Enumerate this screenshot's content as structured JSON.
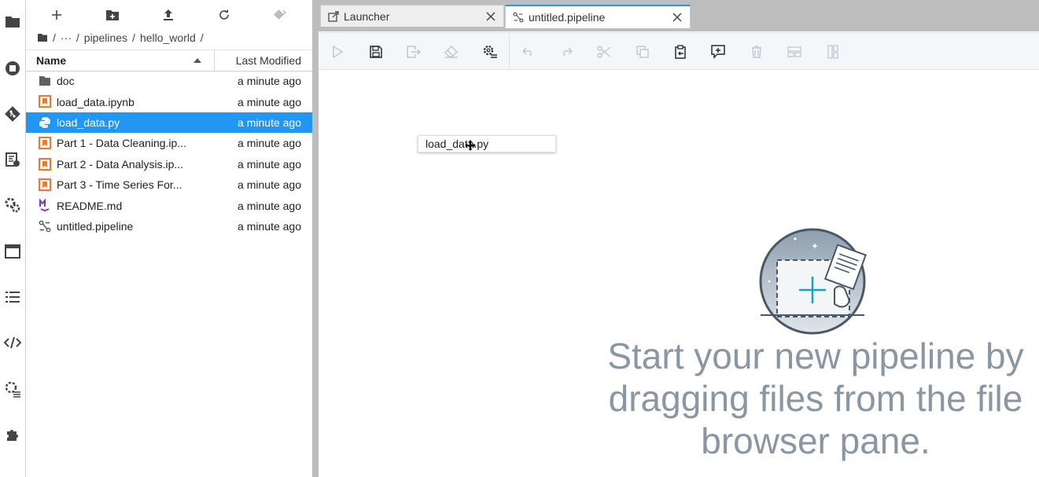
{
  "activity_bar": {
    "items": [
      {
        "name": "folder-icon"
      },
      {
        "name": "running-icon"
      },
      {
        "name": "git-icon"
      },
      {
        "name": "code-snippets-icon"
      },
      {
        "name": "runtimes-icon"
      },
      {
        "name": "tabs-icon"
      },
      {
        "name": "toc-icon"
      },
      {
        "name": "code-icon"
      },
      {
        "name": "property-inspector-icon"
      },
      {
        "name": "extension-icon"
      }
    ]
  },
  "file_browser": {
    "toolbar": [
      "new-launcher-icon",
      "new-folder-icon",
      "upload-icon",
      "refresh-icon",
      "git-clone-icon"
    ],
    "breadcrumb": {
      "root_sep": "/",
      "ellipsis": "···",
      "sep1": "/",
      "part1": "pipelines",
      "sep2": "/",
      "part2": "hello_world",
      "sep3": "/"
    },
    "columns": {
      "name": "Name",
      "modified": "Last Modified"
    },
    "sort": {
      "column": "Name",
      "direction": "ascending"
    },
    "files": [
      {
        "name": "doc",
        "modified": "a minute ago",
        "icon": "folder-icon",
        "selected": false
      },
      {
        "name": "load_data.ipynb",
        "modified": "a minute ago",
        "icon": "notebook-icon",
        "selected": false
      },
      {
        "name": "load_data.py",
        "modified": "a minute ago",
        "icon": "python-icon",
        "selected": true
      },
      {
        "name": "Part 1 - Data Cleaning.ip...",
        "modified": "a minute ago",
        "icon": "notebook-icon",
        "selected": false
      },
      {
        "name": "Part 2 - Data Analysis.ip...",
        "modified": "a minute ago",
        "icon": "notebook-icon",
        "selected": false
      },
      {
        "name": "Part 3 - Time Series For...",
        "modified": "a minute ago",
        "icon": "notebook-icon",
        "selected": false
      },
      {
        "name": "README.md",
        "modified": "a minute ago",
        "icon": "markdown-icon",
        "selected": false
      },
      {
        "name": "untitled.pipeline",
        "modified": "a minute ago",
        "icon": "pipeline-icon",
        "selected": false
      }
    ]
  },
  "tabs": [
    {
      "label": "Launcher",
      "icon": "launcher-icon",
      "active": false
    },
    {
      "label": "untitled.pipeline",
      "icon": "pipeline-icon",
      "active": true
    }
  ],
  "pipeline_toolbar": {
    "buttons": [
      {
        "name": "run-pipeline-button",
        "icon": "play-icon",
        "enabled": false
      },
      {
        "name": "save-pipeline-button",
        "icon": "save-icon",
        "enabled": true
      },
      {
        "name": "export-pipeline-button",
        "icon": "export-icon",
        "enabled": false
      },
      {
        "name": "clear-pipeline-button",
        "icon": "eraser-icon",
        "enabled": false
      },
      {
        "name": "runtimes-button",
        "icon": "runtimes-icon",
        "enabled": true
      },
      {
        "name": "undo-button",
        "icon": "undo-icon",
        "enabled": false
      },
      {
        "name": "redo-button",
        "icon": "redo-icon",
        "enabled": false
      },
      {
        "name": "cut-button",
        "icon": "cut-icon",
        "enabled": false
      },
      {
        "name": "copy-button",
        "icon": "copy-icon",
        "enabled": false
      },
      {
        "name": "paste-button",
        "icon": "paste-icon",
        "enabled": true
      },
      {
        "name": "add-comment-button",
        "icon": "comment-icon",
        "enabled": true
      },
      {
        "name": "delete-button",
        "icon": "trash-icon",
        "enabled": false
      },
      {
        "name": "arrange-horizontal-button",
        "icon": "arrange-horizontal-icon",
        "enabled": false
      },
      {
        "name": "arrange-vertical-button",
        "icon": "arrange-vertical-icon",
        "enabled": false
      }
    ]
  },
  "canvas": {
    "drag_ghost_label": "load_data.py",
    "empty_message": "Start your new pipeline by dragging files from the file browser pane."
  },
  "colors": {
    "accent": "#2196f3",
    "selected_row": "#2196f3",
    "notebook_orange": "#f37726",
    "python_blue": "#3572a5",
    "markdown_purple": "#7b3fa8",
    "empty_text": "#8a96a3"
  }
}
